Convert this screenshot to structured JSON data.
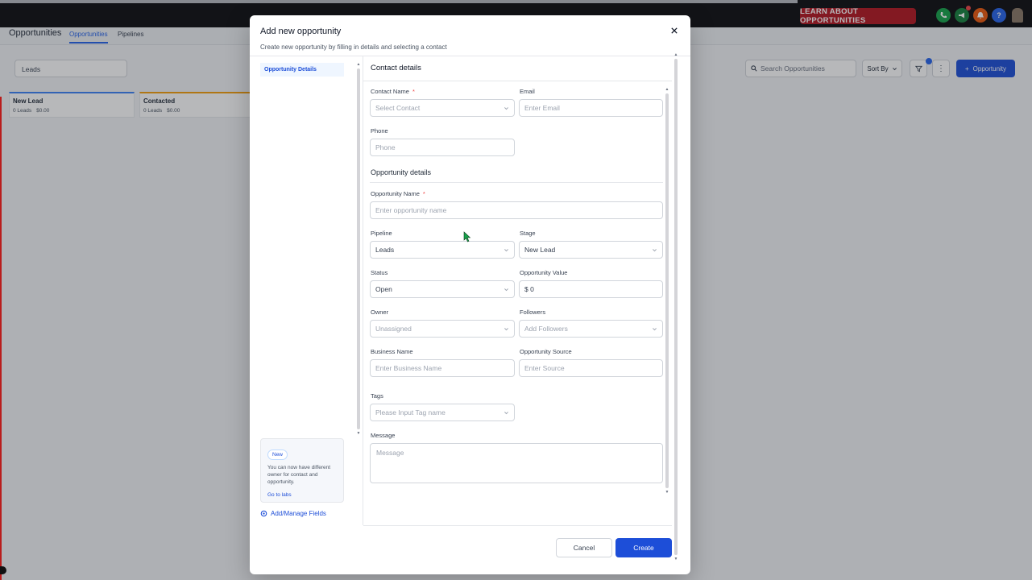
{
  "topbar": {
    "learn_button": "LEARN ABOUT OPPORTUNITIES",
    "icons": [
      "phone-icon",
      "megaphone-icon",
      "bell-icon",
      "help-icon"
    ],
    "colors": {
      "learn_bg": "#b3151f",
      "phone": "#16a34a",
      "megaphone": "#15803d",
      "bell": "#ea580c",
      "help": "#2563eb"
    }
  },
  "page": {
    "title": "Opportunities",
    "tabs": [
      "Opportunities",
      "Pipelines"
    ],
    "active_tab": "Opportunities",
    "pipeline_select": "Leads",
    "search_placeholder": "Search Opportunities",
    "sort_label": "Sort By",
    "add_button": "Opportunity",
    "stages": [
      {
        "name": "New Lead",
        "count": "0 Leads",
        "value": "$0.00"
      },
      {
        "name": "Contacted",
        "count": "0 Leads",
        "value": "$0.00"
      }
    ]
  },
  "modal": {
    "title": "Add new opportunity",
    "subtitle": "Create new opportunity by filling in details and selecting a contact",
    "side_nav": [
      "Opportunity Details"
    ],
    "new_card": {
      "badge": "New",
      "text": "You can now have different owner for contact and opportunity.",
      "link": "Go to labs"
    },
    "manage_fields": "Add/Manage Fields",
    "contact_section": "Contact details",
    "opportunity_section": "Opportunity details",
    "fields": {
      "contact_name": {
        "label": "Contact Name",
        "placeholder": "Select Contact",
        "required": "*"
      },
      "email": {
        "label": "Email",
        "placeholder": "Enter Email"
      },
      "phone": {
        "label": "Phone",
        "placeholder": "Phone"
      },
      "opportunity_name": {
        "label": "Opportunity Name",
        "placeholder": "Enter opportunity name",
        "required": "*"
      },
      "pipeline": {
        "label": "Pipeline",
        "value": "Leads"
      },
      "stage": {
        "label": "Stage",
        "value": "New Lead"
      },
      "status": {
        "label": "Status",
        "value": "Open"
      },
      "opportunity_value": {
        "label": "Opportunity Value",
        "value": "$ 0"
      },
      "owner": {
        "label": "Owner",
        "placeholder": "Unassigned"
      },
      "followers": {
        "label": "Followers",
        "placeholder": "Add Followers"
      },
      "business_name": {
        "label": "Business Name",
        "placeholder": "Enter Business Name"
      },
      "opportunity_source": {
        "label": "Opportunity Source",
        "placeholder": "Enter Source"
      },
      "tags": {
        "label": "Tags",
        "placeholder": "Please Input Tag name"
      },
      "message": {
        "label": "Message",
        "placeholder": "Message"
      }
    },
    "buttons": {
      "cancel": "Cancel",
      "create": "Create"
    }
  }
}
